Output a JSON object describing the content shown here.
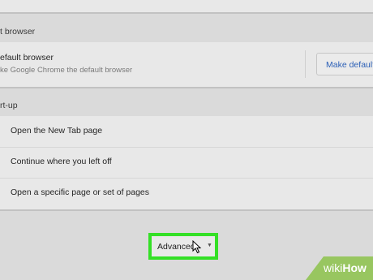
{
  "default_browser": {
    "section_title": "t browser",
    "title": "efault browser",
    "subtitle": "ke Google Chrome the default browser",
    "button_label": "Make default"
  },
  "startup": {
    "section_title": "rt-up",
    "options": [
      {
        "label": "Open the New Tab page"
      },
      {
        "label": "Continue where you left off"
      },
      {
        "label": "Open a specific page or set of pages"
      }
    ]
  },
  "advanced": {
    "label": "Advanced",
    "highlight_color": "#34e026"
  },
  "watermark": {
    "brand_prefix": "wiki",
    "brand_suffix": "How",
    "color": "#8cc24a"
  }
}
